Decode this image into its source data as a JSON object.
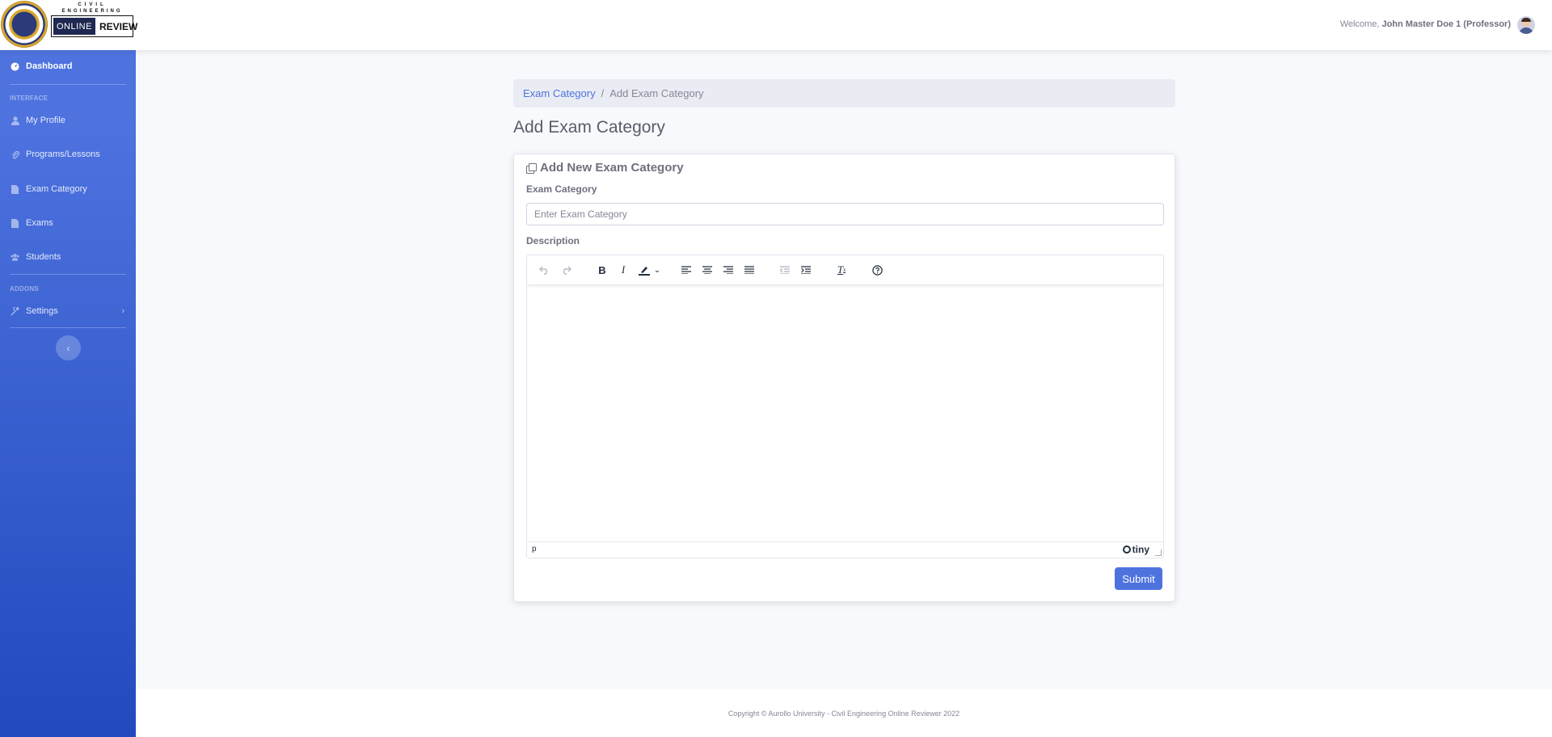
{
  "topbar": {
    "logo": {
      "line1": "CIVIL",
      "line2": "ENGINEERING",
      "online": "ONLINE",
      "review": "REVIEW"
    },
    "welcome_prefix": "Welcome,",
    "user_name": "John Master Doe 1 (Professor)"
  },
  "sidebar": {
    "dashboard": "Dashboard",
    "heading_interface": "INTERFACE",
    "items": [
      {
        "label": "My Profile",
        "icon": "user-icon"
      },
      {
        "label": "Programs/Lessons",
        "icon": "paperclip-icon"
      },
      {
        "label": "Exam Category",
        "icon": "file-icon"
      },
      {
        "label": "Exams",
        "icon": "file-icon"
      },
      {
        "label": "Students",
        "icon": "users-icon"
      }
    ],
    "heading_addons": "ADDONS",
    "settings": "Settings"
  },
  "breadcrumb": {
    "link": "Exam Category",
    "current": "Add Exam Category"
  },
  "page_title": "Add Exam Category",
  "form": {
    "card_title": "Add New Exam Category",
    "category_label": "Exam Category",
    "category_placeholder": "Enter Exam Category",
    "category_value": "",
    "description_label": "Description",
    "editor_path": "p",
    "editor_brand": "tiny",
    "submit_label": "Submit"
  },
  "footer": {
    "copyright": "Copyright © Aurollo University - Civil Engineering Online Reviewer 2022"
  },
  "colors": {
    "primary": "#4e73df",
    "sidebar_end": "#224abe",
    "background": "#f8f9fc"
  }
}
